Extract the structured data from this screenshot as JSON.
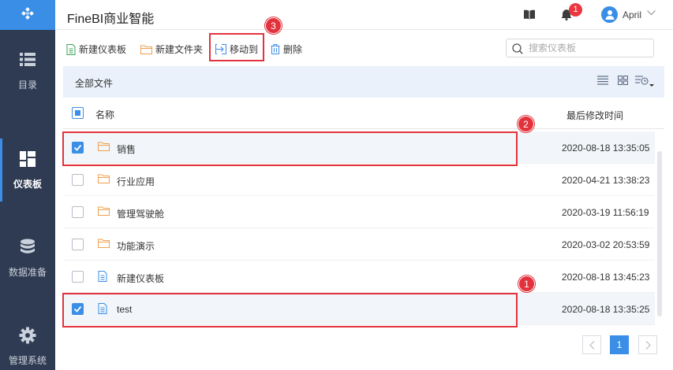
{
  "header": {
    "app_title": "FineBI商业智能",
    "notification_count": "1",
    "user_name": "April"
  },
  "sidebar": {
    "items": [
      {
        "label": "目录"
      },
      {
        "label": "仪表板"
      },
      {
        "label": "数据准备"
      },
      {
        "label": "管理系统"
      }
    ]
  },
  "toolbar": {
    "new_dashboard": "新建仪表板",
    "new_folder": "新建文件夹",
    "move_to": "移动到",
    "delete": "删除",
    "search_placeholder": "搜索仪表板"
  },
  "breadcrumb": "全部文件",
  "list": {
    "col_name": "名称",
    "col_modified": "最后修改时间",
    "rows": [
      {
        "name": "销售",
        "type": "folder",
        "modified": "2020-08-18 13:35:05",
        "checked": true
      },
      {
        "name": "行业应用",
        "type": "folder",
        "modified": "2020-04-21 13:38:23",
        "checked": false
      },
      {
        "name": "管理驾驶舱",
        "type": "folder",
        "modified": "2020-03-19 11:56:19",
        "checked": false
      },
      {
        "name": "功能演示",
        "type": "folder",
        "modified": "2020-03-02 20:53:59",
        "checked": false
      },
      {
        "name": "新建仪表板",
        "type": "dashboard",
        "modified": "2020-08-18 13:45:23",
        "checked": false
      },
      {
        "name": "test",
        "type": "dashboard",
        "modified": "2020-08-18 13:35:25",
        "checked": true
      }
    ]
  },
  "pagination": {
    "current": "1"
  },
  "annotations": [
    "1",
    "2",
    "3"
  ],
  "colors": {
    "accent": "#3a8ee6",
    "sidebar": "#2f3b52",
    "highlight": "#e2333d",
    "folder": "#f0a04b"
  }
}
